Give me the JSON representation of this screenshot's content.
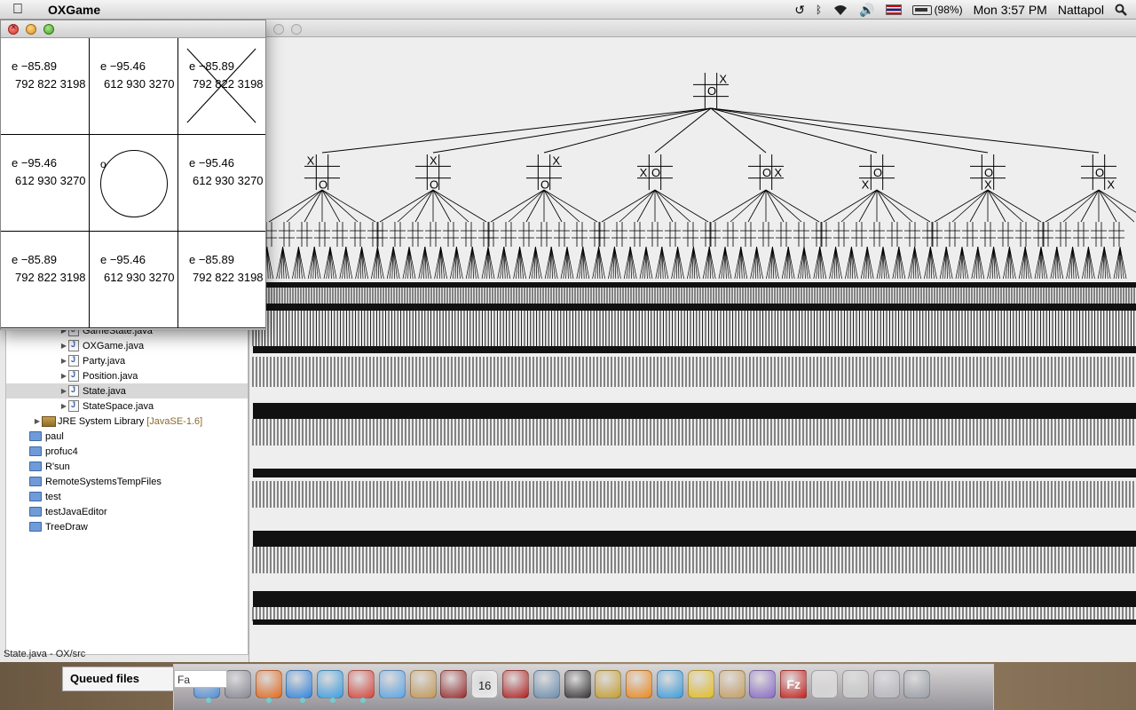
{
  "menubar": {
    "app_name": "OXGame",
    "battery": "(98%)",
    "clock": "Mon 3:57 PM",
    "user": "Nattapol",
    "icons": [
      "apple-icon",
      "time-machine-icon",
      "bluetooth-icon",
      "wifi-icon",
      "volume-icon",
      "thai-flag-icon",
      "battery-icon",
      "spotlight-icon"
    ]
  },
  "board": {
    "cells": [
      {
        "row": 0,
        "col": 0,
        "eval": "e −85.89",
        "id": "792 822 3198",
        "mark": ""
      },
      {
        "row": 0,
        "col": 1,
        "eval": "e −95.46",
        "id": "612 930 3270",
        "mark": ""
      },
      {
        "row": 0,
        "col": 2,
        "eval": "e −85.89",
        "id": "792 822 3198",
        "mark": "X"
      },
      {
        "row": 1,
        "col": 0,
        "eval": "e −95.46",
        "id": "612 930 3270",
        "mark": ""
      },
      {
        "row": 1,
        "col": 1,
        "eval": "",
        "id": "",
        "mark": "O",
        "label": "o"
      },
      {
        "row": 1,
        "col": 2,
        "eval": "e −95.46",
        "id": "612 930 3270",
        "mark": ""
      },
      {
        "row": 2,
        "col": 0,
        "eval": "e −85.89",
        "id": "792 822 3198",
        "mark": ""
      },
      {
        "row": 2,
        "col": 1,
        "eval": "e −95.46",
        "id": "612 930 3270",
        "mark": ""
      },
      {
        "row": 2,
        "col": 2,
        "eval": "e −85.89",
        "id": "792 822 3198",
        "mark": ""
      }
    ]
  },
  "explorer": {
    "items": [
      {
        "label": "GameState.java",
        "kind": "java",
        "indent": 3,
        "selected": false
      },
      {
        "label": "OXGame.java",
        "kind": "java",
        "indent": 3,
        "selected": false
      },
      {
        "label": "Party.java",
        "kind": "java",
        "indent": 3,
        "selected": false
      },
      {
        "label": "Position.java",
        "kind": "java",
        "indent": 3,
        "selected": false
      },
      {
        "label": "State.java",
        "kind": "java",
        "indent": 3,
        "selected": true
      },
      {
        "label": "StateSpace.java",
        "kind": "java",
        "indent": 3,
        "selected": false
      },
      {
        "label": "JRE System Library",
        "kind": "lib",
        "indent": 2,
        "selected": false,
        "suffix": "[JavaSE-1.6]"
      },
      {
        "label": "paul",
        "kind": "folder",
        "indent": 1,
        "selected": false
      },
      {
        "label": "profuc4",
        "kind": "folder",
        "indent": 1,
        "selected": false
      },
      {
        "label": "R'sun",
        "kind": "folder",
        "indent": 1,
        "selected": false
      },
      {
        "label": "RemoteSystemsTempFiles",
        "kind": "folder",
        "indent": 1,
        "selected": false
      },
      {
        "label": "test",
        "kind": "folder",
        "indent": 1,
        "selected": false
      },
      {
        "label": "testJavaEditor",
        "kind": "folder",
        "indent": 1,
        "selected": false
      },
      {
        "label": "TreeDraw",
        "kind": "folder",
        "indent": 1,
        "selected": false
      }
    ]
  },
  "statusbar": {
    "text": "State.java - OX/src"
  },
  "dock": {
    "queued_label": "Queued files",
    "queued_text": "Fa",
    "icons": [
      {
        "name": "finder-icon",
        "color": "#4f8fd8"
      },
      {
        "name": "launchpad-icon",
        "color": "#8a8a95"
      },
      {
        "name": "firefox-icon",
        "color": "#e86a1a"
      },
      {
        "name": "app-store-icon",
        "color": "#2f86e0"
      },
      {
        "name": "safari-icon",
        "color": "#3aa0e6"
      },
      {
        "name": "chrome-icon",
        "color": "#d9443a"
      },
      {
        "name": "mail-icon",
        "color": "#5aa7e8"
      },
      {
        "name": "address-book-icon",
        "color": "#c59a55"
      },
      {
        "name": "dictionary-icon",
        "color": "#9a2a2a"
      },
      {
        "name": "calendar-icon",
        "color": "#f0f0f0"
      },
      {
        "name": "photo-booth-icon",
        "color": "#b22020"
      },
      {
        "name": "iphoto-icon",
        "color": "#6a8fb0"
      },
      {
        "name": "imovie-icon",
        "color": "#333333"
      },
      {
        "name": "pineapple-icon",
        "color": "#c8a02a"
      },
      {
        "name": "vlc-icon",
        "color": "#f08a1a"
      },
      {
        "name": "itunes-icon",
        "color": "#3aa0e0"
      },
      {
        "name": "radiation-icon",
        "color": "#e8c020"
      },
      {
        "name": "archive-icon",
        "color": "#c8a060"
      },
      {
        "name": "orb-icon",
        "color": "#8a6ac8"
      },
      {
        "name": "filezilla-icon",
        "color": "#c8201a"
      },
      {
        "name": "tea-cup-icon",
        "color": "#d8d8d8"
      },
      {
        "name": "tea-cup-2-icon",
        "color": "#c8c8c8"
      },
      {
        "name": "documents-stack-icon",
        "color": "#b8b8c0"
      },
      {
        "name": "trash-icon",
        "color": "#9aa0a8"
      }
    ]
  },
  "tree": {
    "root": {
      "mark_x": "X",
      "mark_o": "O"
    },
    "level1": [
      {
        "x": "X",
        "o": "O",
        "xpos": "tl",
        "opos": "bm"
      },
      {
        "x": "X",
        "o": "O",
        "xpos": "tm",
        "opos": "bm"
      },
      {
        "x": "X",
        "o": "O",
        "xpos": "tr",
        "opos": "bm"
      },
      {
        "x": "X",
        "o": "O",
        "xpos": "ml",
        "opos": "mm"
      },
      {
        "x": "X",
        "o": "O",
        "xpos": "mr",
        "opos": "mm"
      },
      {
        "x": "X",
        "o": "O",
        "xpos": "bl",
        "opos": "mm"
      },
      {
        "x": "X",
        "o": "O",
        "xpos": "bm",
        "opos": "mm"
      },
      {
        "x": "X",
        "o": "O",
        "xpos": "br",
        "opos": "mm"
      }
    ]
  }
}
